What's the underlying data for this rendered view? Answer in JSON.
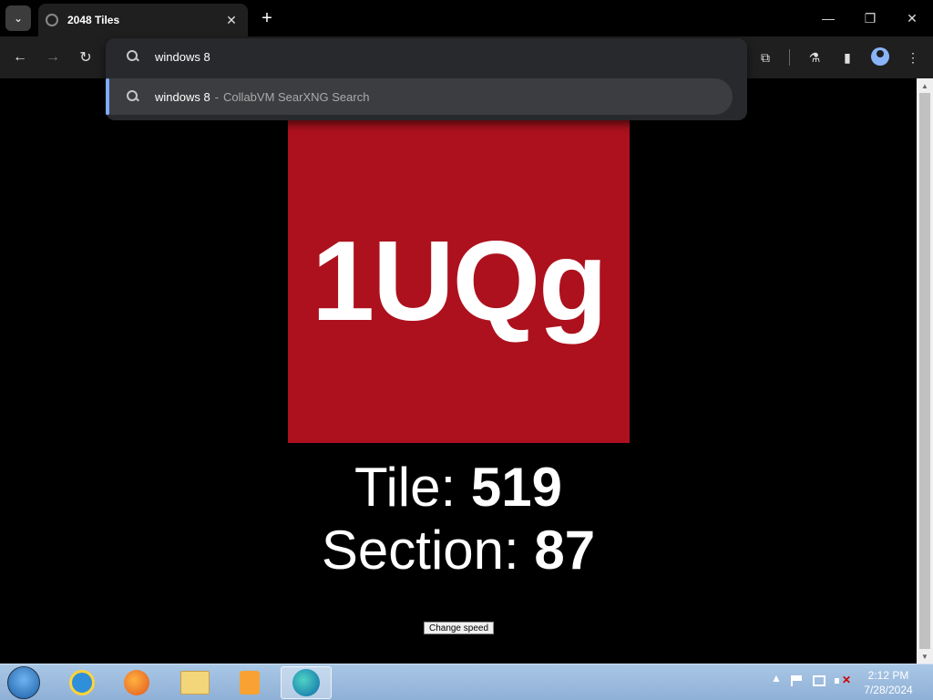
{
  "browser": {
    "tab_title": "2048 Tiles",
    "omnibox_input": "windows 8",
    "suggestion": {
      "query": "windows 8",
      "separator": "-",
      "description": "CollabVM SearXNG Search"
    }
  },
  "page": {
    "tile_text": "1UQg",
    "tile_color": "#ad111d",
    "tile_label": "Tile: ",
    "tile_number": "519",
    "section_label": "Section: ",
    "section_number": "87",
    "speed_button": "Change speed"
  },
  "taskbar": {
    "time": "2:12 PM",
    "date": "7/28/2024",
    "apps": [
      "internet-explorer",
      "firefox",
      "file-explorer",
      "media-player",
      "edge"
    ]
  }
}
